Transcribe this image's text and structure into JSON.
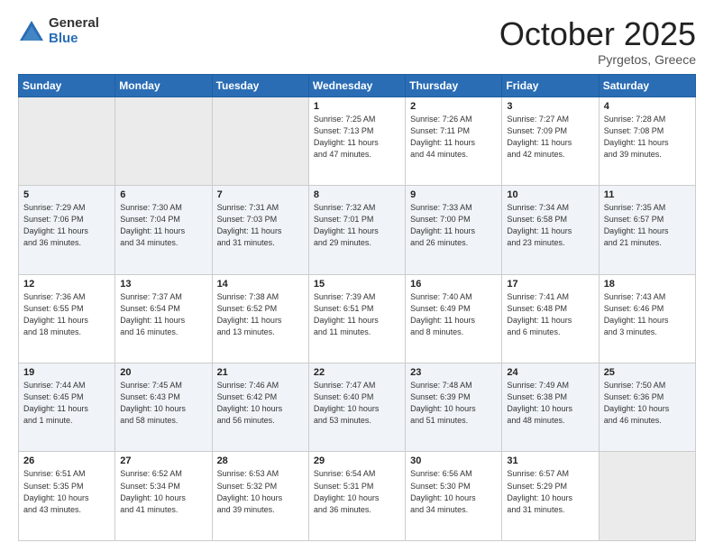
{
  "logo": {
    "general": "General",
    "blue": "Blue"
  },
  "header": {
    "month": "October 2025",
    "location": "Pyrgetos, Greece"
  },
  "days_of_week": [
    "Sunday",
    "Monday",
    "Tuesday",
    "Wednesday",
    "Thursday",
    "Friday",
    "Saturday"
  ],
  "weeks": [
    [
      {
        "day": "",
        "info": ""
      },
      {
        "day": "",
        "info": ""
      },
      {
        "day": "",
        "info": ""
      },
      {
        "day": "1",
        "info": "Sunrise: 7:25 AM\nSunset: 7:13 PM\nDaylight: 11 hours\nand 47 minutes."
      },
      {
        "day": "2",
        "info": "Sunrise: 7:26 AM\nSunset: 7:11 PM\nDaylight: 11 hours\nand 44 minutes."
      },
      {
        "day": "3",
        "info": "Sunrise: 7:27 AM\nSunset: 7:09 PM\nDaylight: 11 hours\nand 42 minutes."
      },
      {
        "day": "4",
        "info": "Sunrise: 7:28 AM\nSunset: 7:08 PM\nDaylight: 11 hours\nand 39 minutes."
      }
    ],
    [
      {
        "day": "5",
        "info": "Sunrise: 7:29 AM\nSunset: 7:06 PM\nDaylight: 11 hours\nand 36 minutes."
      },
      {
        "day": "6",
        "info": "Sunrise: 7:30 AM\nSunset: 7:04 PM\nDaylight: 11 hours\nand 34 minutes."
      },
      {
        "day": "7",
        "info": "Sunrise: 7:31 AM\nSunset: 7:03 PM\nDaylight: 11 hours\nand 31 minutes."
      },
      {
        "day": "8",
        "info": "Sunrise: 7:32 AM\nSunset: 7:01 PM\nDaylight: 11 hours\nand 29 minutes."
      },
      {
        "day": "9",
        "info": "Sunrise: 7:33 AM\nSunset: 7:00 PM\nDaylight: 11 hours\nand 26 minutes."
      },
      {
        "day": "10",
        "info": "Sunrise: 7:34 AM\nSunset: 6:58 PM\nDaylight: 11 hours\nand 23 minutes."
      },
      {
        "day": "11",
        "info": "Sunrise: 7:35 AM\nSunset: 6:57 PM\nDaylight: 11 hours\nand 21 minutes."
      }
    ],
    [
      {
        "day": "12",
        "info": "Sunrise: 7:36 AM\nSunset: 6:55 PM\nDaylight: 11 hours\nand 18 minutes."
      },
      {
        "day": "13",
        "info": "Sunrise: 7:37 AM\nSunset: 6:54 PM\nDaylight: 11 hours\nand 16 minutes."
      },
      {
        "day": "14",
        "info": "Sunrise: 7:38 AM\nSunset: 6:52 PM\nDaylight: 11 hours\nand 13 minutes."
      },
      {
        "day": "15",
        "info": "Sunrise: 7:39 AM\nSunset: 6:51 PM\nDaylight: 11 hours\nand 11 minutes."
      },
      {
        "day": "16",
        "info": "Sunrise: 7:40 AM\nSunset: 6:49 PM\nDaylight: 11 hours\nand 8 minutes."
      },
      {
        "day": "17",
        "info": "Sunrise: 7:41 AM\nSunset: 6:48 PM\nDaylight: 11 hours\nand 6 minutes."
      },
      {
        "day": "18",
        "info": "Sunrise: 7:43 AM\nSunset: 6:46 PM\nDaylight: 11 hours\nand 3 minutes."
      }
    ],
    [
      {
        "day": "19",
        "info": "Sunrise: 7:44 AM\nSunset: 6:45 PM\nDaylight: 11 hours\nand 1 minute."
      },
      {
        "day": "20",
        "info": "Sunrise: 7:45 AM\nSunset: 6:43 PM\nDaylight: 10 hours\nand 58 minutes."
      },
      {
        "day": "21",
        "info": "Sunrise: 7:46 AM\nSunset: 6:42 PM\nDaylight: 10 hours\nand 56 minutes."
      },
      {
        "day": "22",
        "info": "Sunrise: 7:47 AM\nSunset: 6:40 PM\nDaylight: 10 hours\nand 53 minutes."
      },
      {
        "day": "23",
        "info": "Sunrise: 7:48 AM\nSunset: 6:39 PM\nDaylight: 10 hours\nand 51 minutes."
      },
      {
        "day": "24",
        "info": "Sunrise: 7:49 AM\nSunset: 6:38 PM\nDaylight: 10 hours\nand 48 minutes."
      },
      {
        "day": "25",
        "info": "Sunrise: 7:50 AM\nSunset: 6:36 PM\nDaylight: 10 hours\nand 46 minutes."
      }
    ],
    [
      {
        "day": "26",
        "info": "Sunrise: 6:51 AM\nSunset: 5:35 PM\nDaylight: 10 hours\nand 43 minutes."
      },
      {
        "day": "27",
        "info": "Sunrise: 6:52 AM\nSunset: 5:34 PM\nDaylight: 10 hours\nand 41 minutes."
      },
      {
        "day": "28",
        "info": "Sunrise: 6:53 AM\nSunset: 5:32 PM\nDaylight: 10 hours\nand 39 minutes."
      },
      {
        "day": "29",
        "info": "Sunrise: 6:54 AM\nSunset: 5:31 PM\nDaylight: 10 hours\nand 36 minutes."
      },
      {
        "day": "30",
        "info": "Sunrise: 6:56 AM\nSunset: 5:30 PM\nDaylight: 10 hours\nand 34 minutes."
      },
      {
        "day": "31",
        "info": "Sunrise: 6:57 AM\nSunset: 5:29 PM\nDaylight: 10 hours\nand 31 minutes."
      },
      {
        "day": "",
        "info": ""
      }
    ]
  ]
}
